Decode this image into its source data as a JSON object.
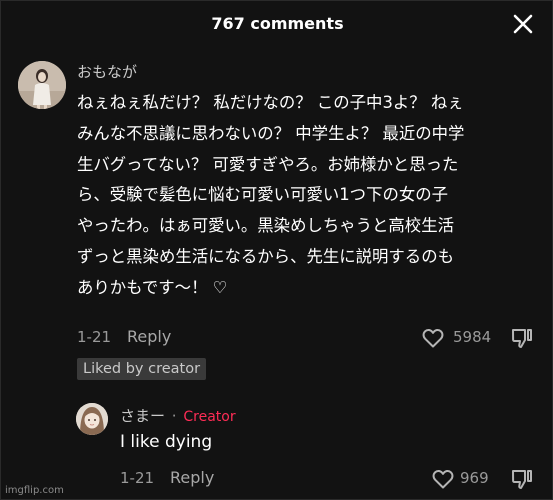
{
  "header": {
    "title": "767 comments"
  },
  "comments": [
    {
      "username": "おもなが",
      "text_lines": [
        "ねぇねぇ私だけ？ 私だけなの？ この子中3よ？ ねぇ",
        "みんな不思議に思わないの？ 中学生よ？ 最近の中学",
        "生バグってない？ 可愛すぎやろ。お姉様かと思った",
        "ら、受験で髪色に悩む可愛い可愛い1つ下の女の子",
        "やったわ。はぁ可愛い。黒染めしちゃうと高校生活",
        "ずっと黒染め生活になるから、先生に説明するのも",
        "ありかもです〜！ ♡"
      ],
      "date": "1-21",
      "reply_label": "Reply",
      "like_count": "5984",
      "badge": "Liked by creator"
    },
    {
      "username": "さまー",
      "separator": "·",
      "creator_label": "Creator",
      "text": "I like dying",
      "date": "1-21",
      "reply_label": "Reply",
      "like_count": "969"
    }
  ],
  "watermark": "imgflip.com",
  "colors": {
    "background": "#121212",
    "creator_accent": "#fe2c55",
    "muted_text": "#9a9a9a"
  },
  "icons": {
    "close": "close-icon",
    "like": "heart-outline-icon",
    "dislike": "thumbs-down-icon"
  }
}
